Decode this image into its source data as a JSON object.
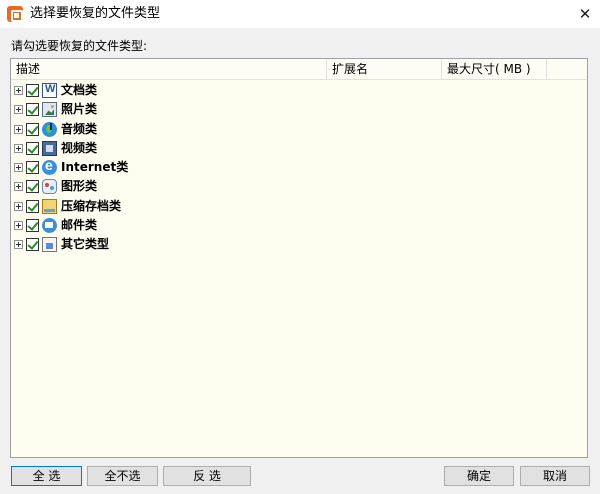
{
  "window": {
    "title": "选择要恢复的文件类型",
    "close_icon": "close-icon"
  },
  "prompt": "请勾选要恢复的文件类型:",
  "columns": [
    "描述",
    "扩展名",
    "最大尺寸( MB )"
  ],
  "items": [
    {
      "label": "文档类",
      "icon": "word-document-icon",
      "checked": true
    },
    {
      "label": "照片类",
      "icon": "photo-icon",
      "checked": true
    },
    {
      "label": "音频类",
      "icon": "audio-icon",
      "checked": true
    },
    {
      "label": "视频类",
      "icon": "video-icon",
      "checked": true
    },
    {
      "label": "Internet类",
      "icon": "internet-explorer-icon",
      "checked": true
    },
    {
      "label": "图形类",
      "icon": "graphics-icon",
      "checked": true
    },
    {
      "label": "压缩存档类",
      "icon": "archive-icon",
      "checked": true
    },
    {
      "label": "邮件类",
      "icon": "mail-icon",
      "checked": true
    },
    {
      "label": "其它类型",
      "icon": "other-file-icon",
      "checked": true
    }
  ],
  "buttons": {
    "select_all": "全 选",
    "select_none": "全不选",
    "invert": "反 选",
    "ok": "确定",
    "cancel": "取消"
  },
  "colors": {
    "list_background": "#fffdf0",
    "check_green": "#2a8a2a",
    "focus_border": "#0078d7"
  }
}
